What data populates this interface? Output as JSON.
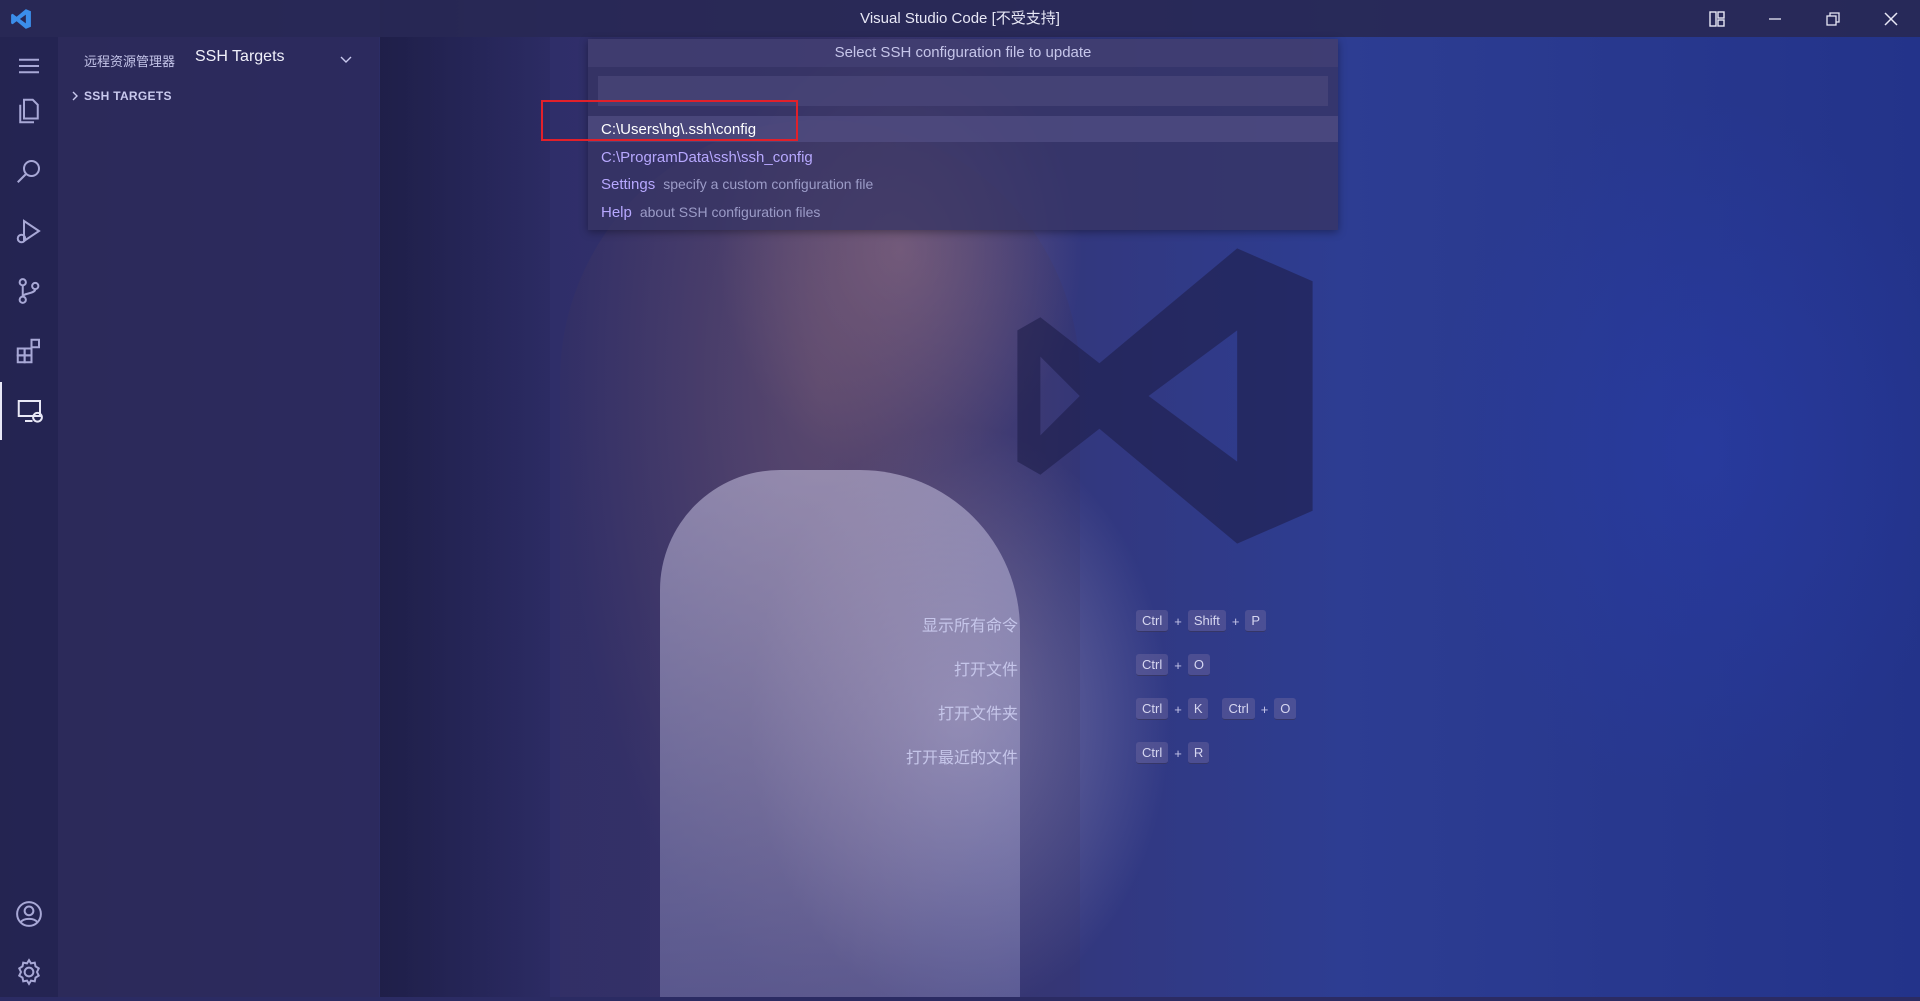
{
  "window": {
    "title": "Visual Studio Code [不受支持]"
  },
  "sidebar": {
    "title": "远程资源管理器",
    "selected_view": "SSH Targets",
    "section_label": "SSH TARGETS"
  },
  "quickpick": {
    "title": "Select SSH configuration file to update",
    "input_value": "",
    "items": [
      {
        "label": "C:\\Users\\hg\\.ssh\\config",
        "description": ""
      },
      {
        "label": "C:\\ProgramData\\ssh\\ssh_config",
        "description": ""
      },
      {
        "label": "Settings",
        "description": "specify a custom configuration file"
      },
      {
        "label": "Help",
        "description": "about SSH configuration files"
      }
    ]
  },
  "shortcuts": [
    {
      "label": "显示所有命令",
      "keys": [
        [
          "Ctrl",
          "Shift",
          "P"
        ]
      ]
    },
    {
      "label": "打开文件",
      "keys": [
        [
          "Ctrl",
          "O"
        ]
      ]
    },
    {
      "label": "打开文件夹",
      "keys": [
        [
          "Ctrl",
          "K"
        ],
        [
          "Ctrl",
          "O"
        ]
      ]
    },
    {
      "label": "打开最近的文件",
      "keys": [
        [
          "Ctrl",
          "R"
        ]
      ]
    }
  ],
  "icons": {
    "menu": "menu-icon",
    "explorer": "files-icon",
    "search": "search-icon",
    "run_debug": "run-debug-icon",
    "source_control": "source-control-icon",
    "extensions": "extensions-icon",
    "remote_explorer": "remote-explorer-icon",
    "accounts": "account-icon",
    "settings": "gear-icon"
  },
  "colors": {
    "highlight_box": "#e2202a",
    "link_label": "#b7a8ff"
  }
}
